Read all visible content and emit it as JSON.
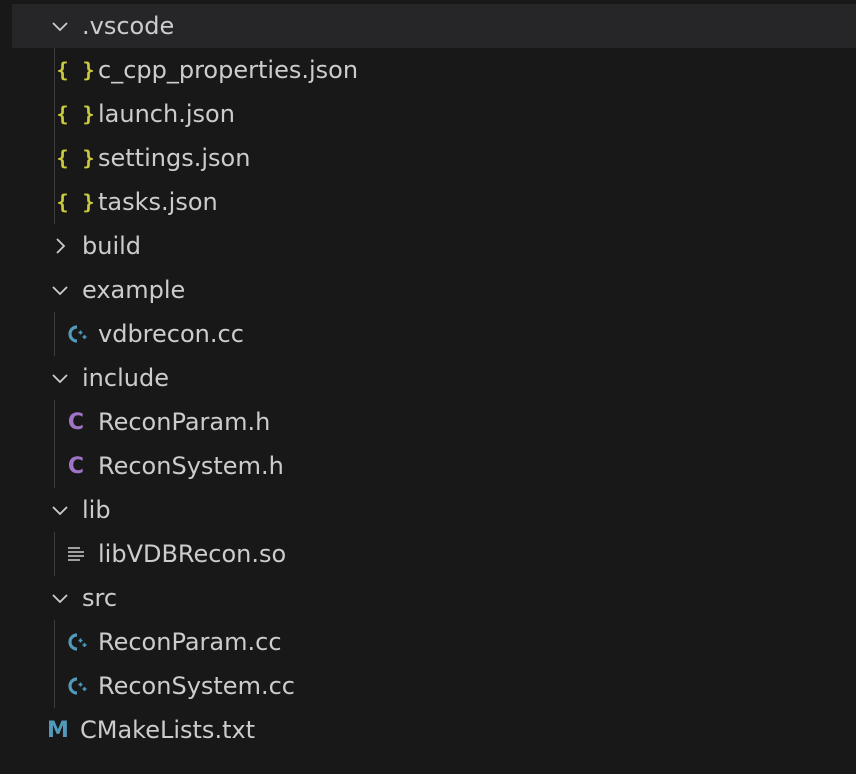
{
  "tree": [
    {
      "label": ".vscode",
      "kind": "folder",
      "expanded": true,
      "depth": 0
    },
    {
      "label": "c_cpp_properties.json",
      "kind": "json",
      "depth": 1
    },
    {
      "label": "launch.json",
      "kind": "json",
      "depth": 1
    },
    {
      "label": "settings.json",
      "kind": "json",
      "depth": 1
    },
    {
      "label": "tasks.json",
      "kind": "json",
      "depth": 1
    },
    {
      "label": "build",
      "kind": "folder",
      "expanded": false,
      "depth": 0
    },
    {
      "label": "example",
      "kind": "folder",
      "expanded": true,
      "depth": 0
    },
    {
      "label": "vdbrecon.cc",
      "kind": "cpp",
      "depth": 1
    },
    {
      "label": "include",
      "kind": "folder",
      "expanded": true,
      "depth": 0
    },
    {
      "label": "ReconParam.h",
      "kind": "c",
      "depth": 1
    },
    {
      "label": "ReconSystem.h",
      "kind": "c",
      "depth": 1
    },
    {
      "label": "lib",
      "kind": "folder",
      "expanded": true,
      "depth": 0
    },
    {
      "label": "libVDBRecon.so",
      "kind": "binary",
      "depth": 1
    },
    {
      "label": "src",
      "kind": "folder",
      "expanded": true,
      "depth": 0
    },
    {
      "label": "ReconParam.cc",
      "kind": "cpp",
      "depth": 1
    },
    {
      "label": "ReconSystem.cc",
      "kind": "cpp",
      "depth": 1
    },
    {
      "label": "CMakeLists.txt",
      "kind": "cmake",
      "depth": 0
    }
  ],
  "icons": {
    "json": "{ }",
    "c": "C",
    "cmake": "M"
  },
  "colors": {
    "background": "#181818",
    "selected_row": "#262628",
    "text": "#cccccc",
    "json_icon": "#cbcb41",
    "c_icon": "#a074c4",
    "cpp_icon": "#519aba",
    "cmake_icon": "#519aba"
  }
}
